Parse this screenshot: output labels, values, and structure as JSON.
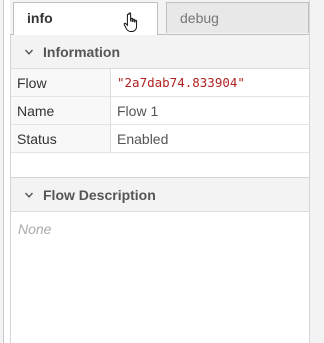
{
  "tabs": [
    {
      "label": "info",
      "active": true
    },
    {
      "label": "debug",
      "active": false
    }
  ],
  "info_section": {
    "title": "Information",
    "rows": [
      {
        "key": "Flow",
        "value": "\"2a7dab74.833904\""
      },
      {
        "key": "Name",
        "value": "Flow 1"
      },
      {
        "key": "Status",
        "value": "Enabled"
      }
    ]
  },
  "description_section": {
    "title": "Flow Description",
    "body": "None"
  },
  "colors": {
    "accent_code": "#b22222",
    "header_bg": "#f3f3f3",
    "placeholder": "#aaaaaa"
  },
  "icons": [
    "chevron-down-icon",
    "hand-cursor-icon"
  ]
}
